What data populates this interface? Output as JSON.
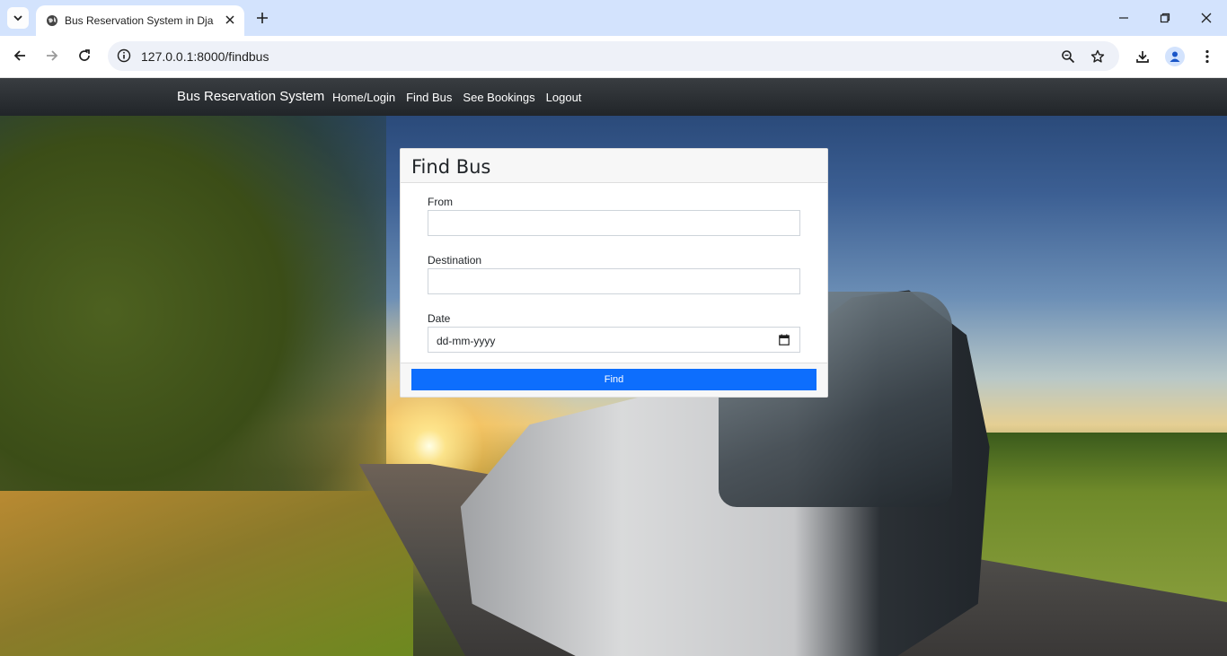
{
  "browser": {
    "tab_title": "Bus Reservation System in Djan",
    "url": "127.0.0.1:8000/findbus"
  },
  "navbar": {
    "brand": "Bus Reservation System",
    "links": [
      "Home/Login",
      "Find Bus",
      "See Bookings",
      "Logout"
    ]
  },
  "form": {
    "title": "Find Bus",
    "from_label": "From",
    "from_value": "",
    "destination_label": "Destination",
    "destination_value": "",
    "date_label": "Date",
    "date_placeholder": "dd-mm-yyyy",
    "submit_label": "Find"
  },
  "colors": {
    "navbar": "#212529",
    "primary_button": "#0d6efd",
    "tabstrip": "#d3e3fd"
  },
  "icons": [
    "tab-list-icon",
    "globe-icon",
    "close-icon",
    "plus-icon",
    "minimize-icon",
    "restore-icon",
    "back-icon",
    "forward-icon",
    "reload-icon",
    "site-info-icon",
    "zoom-icon",
    "star-icon",
    "download-icon",
    "profile-icon",
    "menu-icon",
    "calendar-icon"
  ]
}
